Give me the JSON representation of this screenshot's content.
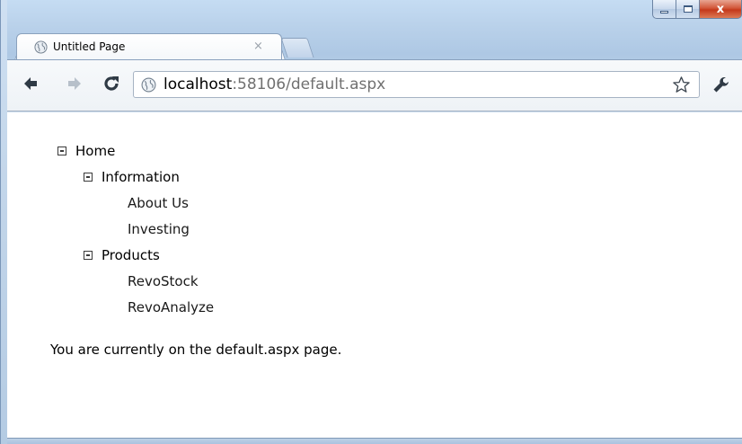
{
  "window": {
    "close_glyph": "x"
  },
  "tab": {
    "title": "Untitled Page",
    "close_glyph": "×",
    "favicon": "globe-icon"
  },
  "toolbar": {
    "back_icon": "back-arrow-icon",
    "forward_icon": "forward-arrow-icon",
    "reload_icon": "reload-icon",
    "bookmark_icon": "star-icon",
    "menu_icon": "wrench-icon"
  },
  "address_bar": {
    "host": "localhost",
    "path": ":58106/default.aspx"
  },
  "tree": {
    "home": "Home",
    "information": "Information",
    "about_us": "About Us",
    "investing": "Investing",
    "products": "Products",
    "revostock": "RevoStock",
    "revoanalyze": "RevoAnalyze"
  },
  "page": {
    "status_text": "You are currently on the default.aspx page."
  },
  "colors": {
    "frame": "#b9d1ea",
    "close_button": "#c4381b",
    "url_path": "#707070"
  }
}
